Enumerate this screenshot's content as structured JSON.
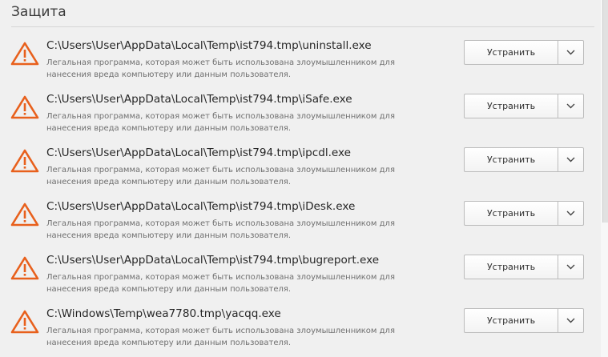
{
  "section": {
    "title": "Защита"
  },
  "threats": [
    {
      "path": "C:\\Users\\User\\AppData\\Local\\Temp\\ist794.tmp\\uninstall.exe",
      "description": "Легальная программа, которая может быть использована злоумышленником для нанесения вреда компьютеру или данным пользователя.",
      "action_label": "Устранить"
    },
    {
      "path": "C:\\Users\\User\\AppData\\Local\\Temp\\ist794.tmp\\iSafe.exe",
      "description": "Легальная программа, которая может быть использована злоумышленником для нанесения вреда компьютеру или данным пользователя.",
      "action_label": "Устранить"
    },
    {
      "path": "C:\\Users\\User\\AppData\\Local\\Temp\\ist794.tmp\\ipcdl.exe",
      "description": "Легальная программа, которая может быть использована злоумышленником для нанесения вреда компьютеру или данным пользователя.",
      "action_label": "Устранить"
    },
    {
      "path": "C:\\Users\\User\\AppData\\Local\\Temp\\ist794.tmp\\iDesk.exe",
      "description": "Легальная программа, которая может быть использована злоумышленником для нанесения вреда компьютеру или данным пользователя.",
      "action_label": "Устранить"
    },
    {
      "path": "C:\\Users\\User\\AppData\\Local\\Temp\\ist794.tmp\\bugreport.exe",
      "description": "Легальная программа, которая может быть использована злоумышленником для нанесения вреда компьютеру или данным пользователя.",
      "action_label": "Устранить"
    },
    {
      "path": "C:\\Windows\\Temp\\wea7780.tmp\\yacqq.exe",
      "description": "Легальная программа, которая может быть использована злоумышленником для нанесения вреда компьютеру или данным пользователя.",
      "action_label": "Устранить"
    }
  ],
  "icons": {
    "warning": "warning-triangle-icon",
    "dropdown": "chevron-down-icon"
  },
  "colors": {
    "warning": "#e8601c",
    "background": "#f0f0f0",
    "path_text": "#262626",
    "description_text": "#6f6f6f"
  }
}
